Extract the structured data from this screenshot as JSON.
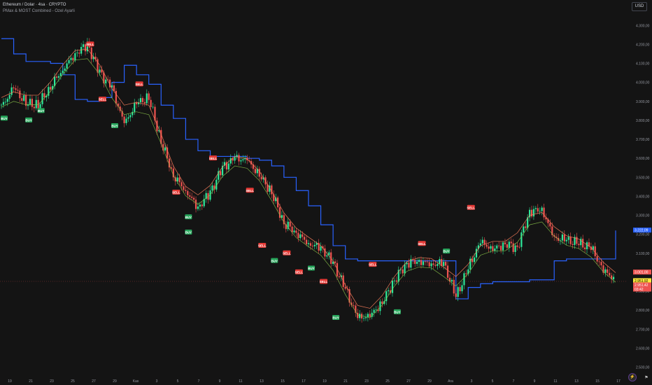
{
  "header": {
    "symbol_line": "Ethereum / Dolar · 4sa · CRYPTO",
    "indicator_line": "PMax & MOST Combined - Ozel Ayarli"
  },
  "currency_button": "USD",
  "colors": {
    "background": "#141414",
    "up": "#26a69a",
    "up_bright": "#2ee89a",
    "down": "#ef5350",
    "blue_line": "#2962ff",
    "pmax_line": "#f77c5b",
    "most_line": "#8bc34a",
    "buy_tag": "#26a65b",
    "sell_tag": "#e53935"
  },
  "chart_data": {
    "type": "line",
    "y_axis": {
      "ticks": [
        "4.300,00",
        "4.200,00",
        "4.100,00",
        "4.000,00",
        "3.900,00",
        "3.800,00",
        "3.700,00",
        "3.600,00",
        "3.500,00",
        "3.400,00",
        "3.300,00",
        "3.200,00",
        "3.100,00",
        "3.000,00",
        "2.900,00",
        "2.800,00",
        "2.700,00",
        "2.600,00",
        "2.500,00"
      ],
      "range": [
        2480,
        4360
      ]
    },
    "x_axis": {
      "ticks": [
        "19",
        "21",
        "23",
        "25",
        "27",
        "29",
        "Kas",
        "3",
        "5",
        "7",
        "9",
        "11",
        "13",
        "15",
        "17",
        "19",
        "21",
        "23",
        "25",
        "27",
        "29",
        "Ara",
        "3",
        "5",
        "7",
        "9",
        "11",
        "13",
        "15",
        "17"
      ]
    },
    "series": [
      {
        "key": "blue_trail",
        "values": [
          4230,
          4150,
          4110,
          4110,
          4100,
          4040,
          3910,
          3900,
          3920,
          4000,
          4090,
          4040,
          3990,
          3880,
          3810,
          3700,
          3640,
          3610,
          3610,
          3610,
          3600,
          3590,
          3560,
          3500,
          3430,
          3350,
          3250,
          3140,
          3070,
          3060,
          3060,
          3060,
          3060,
          3060,
          3060,
          3060,
          3060,
          2860,
          2920,
          2940,
          2950,
          2950,
          2950,
          2960,
          2960,
          3060,
          3070,
          3070,
          3070,
          3070,
          3220
        ]
      },
      {
        "key": "price",
        "values": [
          3870,
          3970,
          3890,
          3880,
          3980,
          4070,
          4150,
          4200,
          4050,
          3970,
          3780,
          3890,
          3920,
          3690,
          3510,
          3430,
          3340,
          3420,
          3550,
          3600,
          3590,
          3510,
          3420,
          3260,
          3210,
          3150,
          3130,
          3050,
          2910,
          2760,
          2770,
          2840,
          2960,
          3050,
          3060,
          3040,
          3050,
          2870,
          3020,
          3160,
          3120,
          3150,
          3130,
          3320,
          3330,
          3180,
          3170,
          3150,
          3130,
          3010,
          2960
        ]
      }
    ],
    "price_labels": [
      {
        "value": 3222.09,
        "text": "3.222,09",
        "bg": "#2962ff"
      },
      {
        "value": 3001.0,
        "text": "3.001,00",
        "bg": "#ef5350"
      },
      {
        "value": 2951.92,
        "text": "2.951,92",
        "bg": "#ffeb3b"
      },
      {
        "value": 2951.42,
        "text": "2.951,42",
        "bg": "#ef5350"
      },
      {
        "value": 2935,
        "text": "03:42",
        "bg": "#ef5350"
      }
    ],
    "signals": [
      {
        "label": "BUY",
        "x_index": 0,
        "value": 3810
      },
      {
        "label": "BUY",
        "x_index": 2,
        "value": 3800
      },
      {
        "label": "BUY",
        "x_index": 3,
        "value": 3850
      },
      {
        "label": "SELL",
        "x_index": 7,
        "value": 4200
      },
      {
        "label": "SELL",
        "x_index": 8,
        "value": 3910
      },
      {
        "label": "BUY",
        "x_index": 9,
        "value": 3770
      },
      {
        "label": "SELL",
        "x_index": 11,
        "value": 3990
      },
      {
        "label": "SELL",
        "x_index": 14,
        "value": 3420
      },
      {
        "label": "BUY",
        "x_index": 15,
        "value": 3290
      },
      {
        "label": "BUY",
        "x_index": 15,
        "value": 3210
      },
      {
        "label": "SELL",
        "x_index": 17,
        "value": 3600
      },
      {
        "label": "SELL",
        "x_index": 20,
        "value": 3430
      },
      {
        "label": "SELL",
        "x_index": 21,
        "value": 3140
      },
      {
        "label": "BUY",
        "x_index": 22,
        "value": 3060
      },
      {
        "label": "SELL",
        "x_index": 23,
        "value": 3100
      },
      {
        "label": "SELL",
        "x_index": 24,
        "value": 3000
      },
      {
        "label": "BUY",
        "x_index": 25,
        "value": 3020
      },
      {
        "label": "SELL",
        "x_index": 26,
        "value": 2950
      },
      {
        "label": "BUY",
        "x_index": 27,
        "value": 2760
      },
      {
        "label": "SELL",
        "x_index": 30,
        "value": 3040
      },
      {
        "label": "BUY",
        "x_index": 32,
        "value": 2790
      },
      {
        "label": "SELL",
        "x_index": 34,
        "value": 3150
      },
      {
        "label": "BUY",
        "x_index": 36,
        "value": 3110
      },
      {
        "label": "SELL",
        "x_index": 38,
        "value": 3340
      }
    ]
  }
}
